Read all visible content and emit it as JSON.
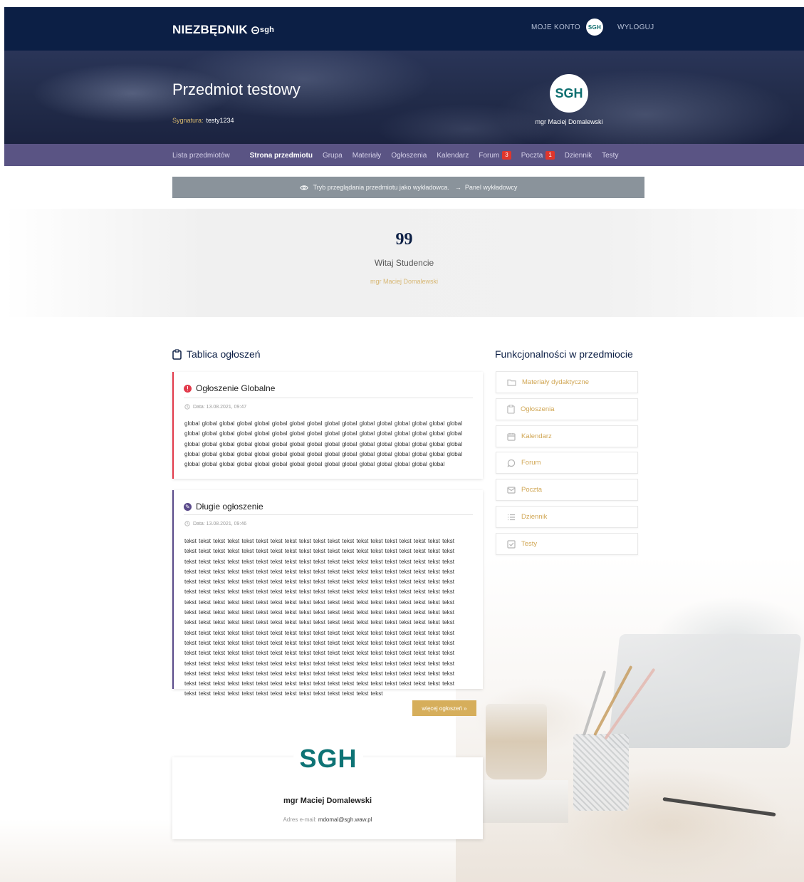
{
  "header": {
    "logo_text": "NIEZBĘDNIK",
    "logo_sub": "sgh",
    "account_label": "MOJE KONTO",
    "account_badge": "SGH",
    "logout_label": "WYLOGUJ"
  },
  "hero": {
    "course_title": "Przedmiot testowy",
    "signature_label": "Sygnatura:",
    "signature_value": "testy1234",
    "lecturer_avatar": "SGH",
    "lecturer_name": "mgr Maciej Domalewski"
  },
  "subnav": {
    "items": [
      {
        "label": "Lista przedmiotów"
      },
      {
        "label": "Strona przedmiotu",
        "active": true
      },
      {
        "label": "Grupa"
      },
      {
        "label": "Materiały"
      },
      {
        "label": "Ogłoszenia"
      },
      {
        "label": "Kalendarz"
      },
      {
        "label": "Forum",
        "badge": "3"
      },
      {
        "label": "Poczta",
        "badge": "1"
      },
      {
        "label": "Dziennik"
      },
      {
        "label": "Testy"
      }
    ]
  },
  "viewbar": {
    "text": "Tryb przeglądania przedmiotu jako wykładowca.",
    "link": "Panel wykładowcy"
  },
  "quote": {
    "mark": "99",
    "text": "Witaj Studencie",
    "author": "mgr Maciej Domalewski"
  },
  "announcements": {
    "title": "Tablica ogłoszeń",
    "items": [
      {
        "title": "Ogłoszenie Globalne",
        "date": "Data: 13.08.2021, 09:47",
        "body": "global global global global global global global global global global global global global global global global global global global global global global global global global global global global global global global global global global global global global global global global global global global global global global global global global global global global global global global global global global global global global global global global global global global global global global global global global global global global global global global"
      },
      {
        "title": "Długie ogłoszenie",
        "date": "Data: 13.08.2021, 09:46",
        "body": "tekst tekst tekst tekst tekst tekst tekst tekst tekst tekst tekst tekst tekst tekst tekst tekst tekst tekst tekst tekst tekst tekst tekst tekst tekst tekst tekst tekst tekst tekst tekst tekst tekst tekst tekst tekst tekst tekst tekst tekst tekst tekst tekst tekst tekst tekst tekst tekst tekst tekst tekst tekst tekst tekst tekst tekst tekst tekst tekst tekst tekst tekst tekst tekst tekst tekst tekst tekst tekst tekst tekst tekst tekst tekst tekst tekst tekst tekst tekst tekst tekst tekst tekst tekst tekst tekst tekst tekst tekst tekst tekst tekst tekst tekst tekst tekst tekst tekst tekst tekst tekst tekst tekst tekst tekst tekst tekst tekst tekst tekst tekst tekst tekst tekst tekst tekst tekst tekst tekst tekst tekst tekst tekst tekst tekst tekst tekst tekst tekst tekst tekst tekst tekst tekst tekst tekst tekst tekst tekst tekst tekst tekst tekst tekst tekst tekst tekst tekst tekst tekst tekst tekst tekst tekst tekst tekst tekst tekst tekst tekst tekst tekst tekst tekst tekst tekst tekst tekst tekst tekst tekst tekst tekst tekst tekst tekst tekst tekst tekst tekst tekst tekst tekst tekst tekst tekst tekst tekst tekst tekst tekst tekst tekst tekst tekst tekst tekst tekst tekst tekst tekst tekst tekst tekst tekst tekst tekst tekst tekst tekst tekst tekst tekst tekst tekst tekst tekst tekst tekst tekst tekst tekst tekst tekst tekst tekst tekst tekst tekst tekst tekst tekst tekst tekst tekst tekst tekst tekst tekst tekst tekst tekst tekst tekst tekst tekst tekst tekst tekst tekst tekst tekst tekst tekst tekst tekst tekst tekst tekst tekst tekst tekst tekst tekst tekst tekst tekst tekst tekst tekst tekst tekst tekst tekst tekst tekst tekst tekst tekst tekst tekst tekst tekst tekst tekst tekst tekst tekst tekst tekst tekst tekst tekst tekst tekst tekst tekst tekst tekst"
      }
    ],
    "more_label": "więcej ogłoszeń »"
  },
  "lecturer_card": {
    "logo": "SGH",
    "name": "mgr Maciej Domalewski",
    "email_label": "Adres e-mail:",
    "email": "mdomal@sgh.waw.pl"
  },
  "features": {
    "title": "Funkcjonalności w przedmiocie",
    "items": [
      {
        "label": "Materiały dydaktyczne",
        "icon": "folder-icon"
      },
      {
        "label": "Ogłoszenia",
        "icon": "clipboard-icon"
      },
      {
        "label": "Kalendarz",
        "icon": "calendar-icon"
      },
      {
        "label": "Forum",
        "icon": "chat-icon"
      },
      {
        "label": "Poczta",
        "icon": "mail-icon"
      },
      {
        "label": "Dziennik",
        "icon": "list-icon"
      },
      {
        "label": "Testy",
        "icon": "checkbox-icon"
      }
    ]
  },
  "colors": {
    "navy": "#0c1f45",
    "subnav": "#5a5484",
    "gold": "#d6ae5b",
    "alert_red": "#e23a4b",
    "purple": "#5a4a8a",
    "sgh_teal": "#0e7375"
  }
}
